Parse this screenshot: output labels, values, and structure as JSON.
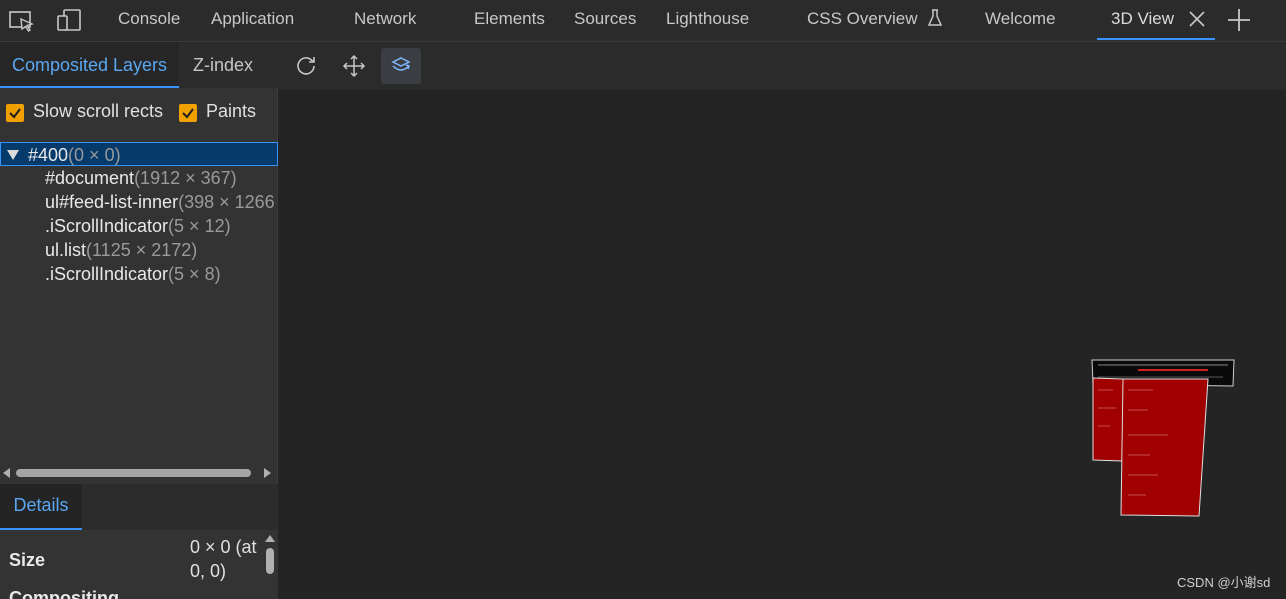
{
  "topbar": {
    "tabs": [
      {
        "label": "Console"
      },
      {
        "label": "Application"
      },
      {
        "label": "Network"
      },
      {
        "label": "Elements"
      },
      {
        "label": "Sources"
      },
      {
        "label": "Lighthouse"
      },
      {
        "label": "CSS Overview"
      },
      {
        "label": "Welcome"
      },
      {
        "label": "3D View"
      }
    ],
    "accent": "#3794ff"
  },
  "left_panel": {
    "subtabs": [
      "Composited Layers",
      "Z-index"
    ],
    "checkboxes": [
      {
        "label": "Slow scroll rects",
        "checked": true
      },
      {
        "label": "Paints",
        "checked": true
      }
    ],
    "tree": [
      {
        "name": "#400",
        "dims": "(0 × 0)",
        "selected": true
      },
      {
        "name": "#document",
        "dims": "(1912 × 367)"
      },
      {
        "name": "ul#feed-list-inner",
        "dims": "(398 × 1266"
      },
      {
        "name": ".iScrollIndicator",
        "dims": "(5 × 12)"
      },
      {
        "name": "ul.list",
        "dims": "(1125 × 2172)"
      },
      {
        "name": ".iScrollIndicator",
        "dims": "(5 × 8)"
      }
    ],
    "details_tab": "Details",
    "details": [
      {
        "key": "Size",
        "value": "0 × 0 (at 0, 0)"
      },
      {
        "key": "Compositing",
        "value": ""
      }
    ]
  },
  "viewport": {
    "layer_color": "#a00000",
    "watermark": "CSDN @小谢sd"
  }
}
